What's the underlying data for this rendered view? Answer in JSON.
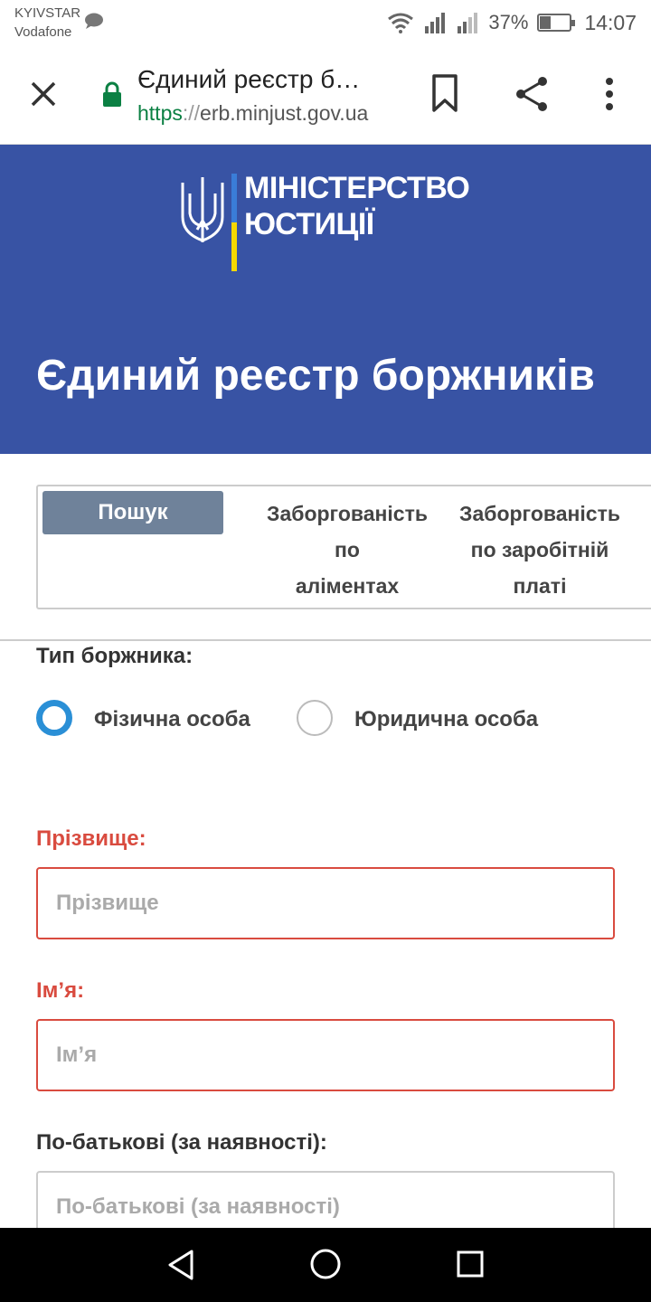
{
  "status_bar": {
    "carrier_1": "KYIVSTAR",
    "carrier_2": "Vodafone",
    "battery_percent": "37%",
    "battery_level": 0.37,
    "time": "14:07"
  },
  "browser": {
    "page_title": "Єдиний реєстр б…",
    "url_scheme": "https",
    "url_sep": "://",
    "url_host": "erb.minjust.gov.ua"
  },
  "hero": {
    "logo_line_1": "МІНІСТЕРСТВО",
    "logo_line_2": "ЮСТИЦІЇ",
    "title": "Єдиний реєстр боржників"
  },
  "tabs": {
    "search": "Пошук",
    "alimony": [
      "Заборгованість",
      "по",
      "аліментах"
    ],
    "salary": [
      "Заборгованість",
      "по заробітній",
      "платі"
    ]
  },
  "form": {
    "debtor_type_label": "Тип боржника:",
    "radio_individual": "Фізична особа",
    "radio_legal": "Юридична особа",
    "surname_label": "Прізвище:",
    "surname_placeholder": "Прізвище",
    "name_label": "Ім’я:",
    "name_placeholder": "Ім’я",
    "patronymic_label": "По-батькові (за наявності):",
    "patronymic_placeholder": "По-батькові (за наявності)"
  },
  "colors": {
    "hero_bg": "#3853a4",
    "tab_active": "#6f829a",
    "required": "#d94b3f",
    "radio_active": "#2a8fd6"
  }
}
